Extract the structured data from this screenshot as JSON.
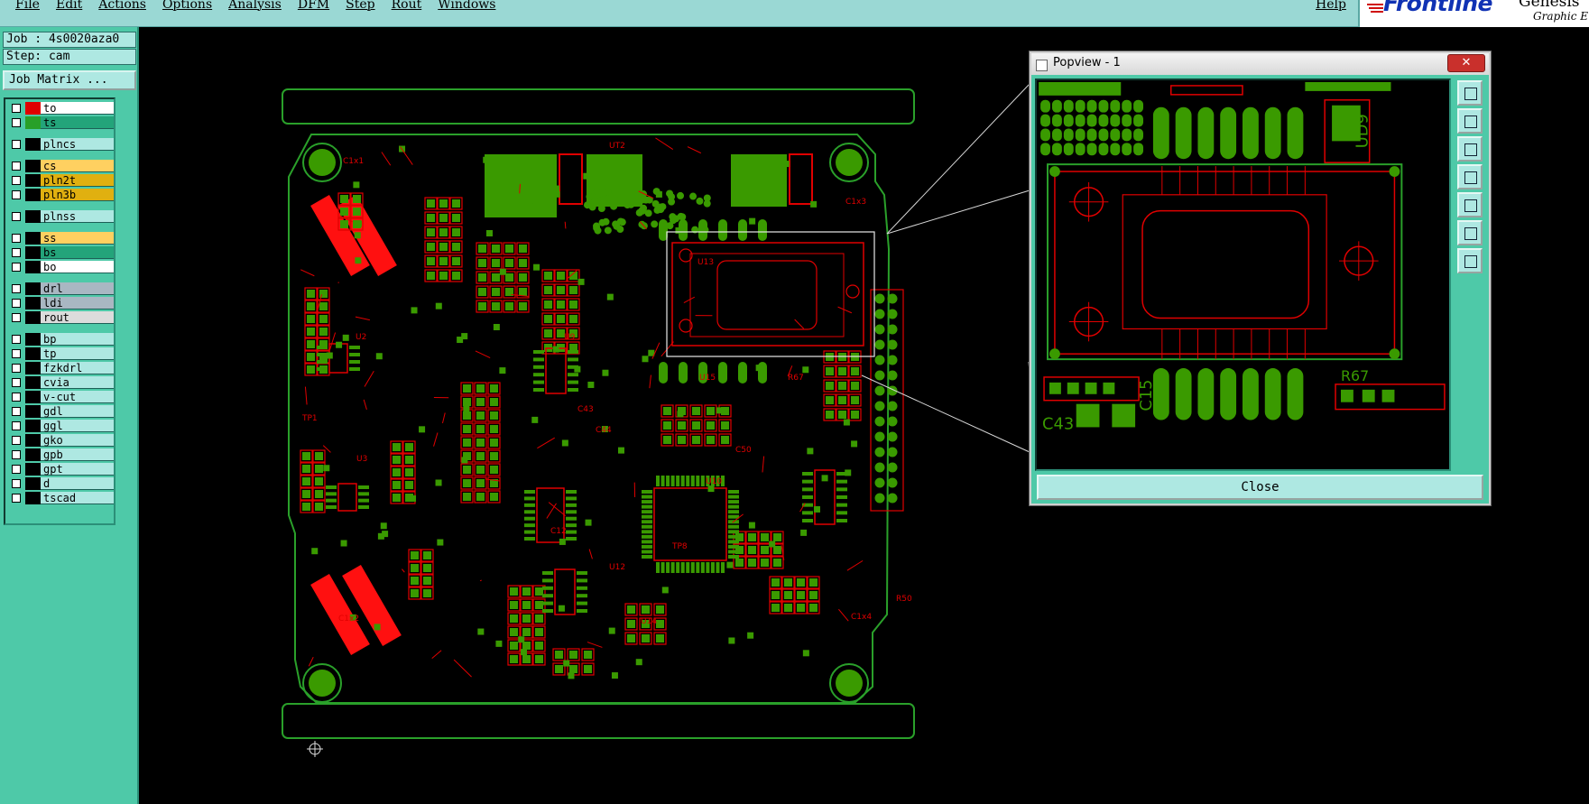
{
  "menubar": {
    "items": [
      "File",
      "Edit",
      "Actions",
      "Options",
      "Analysis",
      "DFM",
      "Step",
      "Rout",
      "Windows"
    ],
    "help": "Help"
  },
  "brand": {
    "logo": "Frontline",
    "side_text": "Genesis",
    "sub_text": "Graphic E"
  },
  "job": {
    "job_line": "Job : 4s0020aza0",
    "step_line": "Step: cam",
    "matrix_button": "Job Matrix ..."
  },
  "layers": [
    {
      "name": "to",
      "color": "#ffffff",
      "swatch": "#e00000"
    },
    {
      "name": "ts",
      "color": "#23a47a",
      "swatch": "#28a028"
    },
    {
      "name": "plncs",
      "color": "#aee8e2",
      "swatch": "#000000"
    },
    {
      "name": "cs",
      "color": "#ffd060",
      "swatch": "#000000"
    },
    {
      "name": "pln2t",
      "color": "#e0b010",
      "swatch": "#000000"
    },
    {
      "name": "pln3b",
      "color": "#e0b010",
      "swatch": "#000000"
    },
    {
      "name": "plnss",
      "color": "#aee8e2",
      "swatch": "#000000"
    },
    {
      "name": "ss",
      "color": "#ffd060",
      "swatch": "#000000"
    },
    {
      "name": "bs",
      "color": "#23a47a",
      "swatch": "#000000"
    },
    {
      "name": "bo",
      "color": "#ffffff",
      "swatch": "#000000"
    },
    {
      "name": "drl",
      "color": "#a9b7c2",
      "swatch": "#000000"
    },
    {
      "name": "ldi",
      "color": "#a9b7c2",
      "swatch": "#000000"
    },
    {
      "name": "rout",
      "color": "#dcdcdc",
      "swatch": "#000000"
    },
    {
      "name": "bp",
      "color": "#aee8e2",
      "swatch": "#000000"
    },
    {
      "name": "tp",
      "color": "#aee8e2",
      "swatch": "#000000"
    },
    {
      "name": "fzkdrl",
      "color": "#aee8e2",
      "swatch": "#000000"
    },
    {
      "name": "cvia",
      "color": "#aee8e2",
      "swatch": "#000000"
    },
    {
      "name": "v-cut",
      "color": "#aee8e2",
      "swatch": "#000000"
    },
    {
      "name": "gdl",
      "color": "#aee8e2",
      "swatch": "#000000"
    },
    {
      "name": "ggl",
      "color": "#aee8e2",
      "swatch": "#000000"
    },
    {
      "name": "gko",
      "color": "#aee8e2",
      "swatch": "#000000"
    },
    {
      "name": "gpb",
      "color": "#aee8e2",
      "swatch": "#000000"
    },
    {
      "name": "gpt",
      "color": "#aee8e2",
      "swatch": "#000000"
    },
    {
      "name": "d",
      "color": "#aee8e2",
      "swatch": "#000000"
    },
    {
      "name": "tscad",
      "color": "#aee8e2",
      "swatch": "#000000"
    }
  ],
  "board": {
    "labels": [
      "C1x1",
      "C1x2",
      "C1x3",
      "C1x4",
      "UT2",
      "U13",
      "U10",
      "U14",
      "U15",
      "U2",
      "U3",
      "U9",
      "U12",
      "C43",
      "C44",
      "C12",
      "C50",
      "R67",
      "R50",
      "TP1",
      "TP8"
    ]
  },
  "popview": {
    "title": "Popview - 1",
    "close_label": "Close",
    "labels": [
      "UD9",
      "C15",
      "C43",
      "R67"
    ]
  },
  "colors": {
    "pad": "#3a9a00",
    "outline": "#e00000",
    "board_edge": "#2aa02a"
  }
}
